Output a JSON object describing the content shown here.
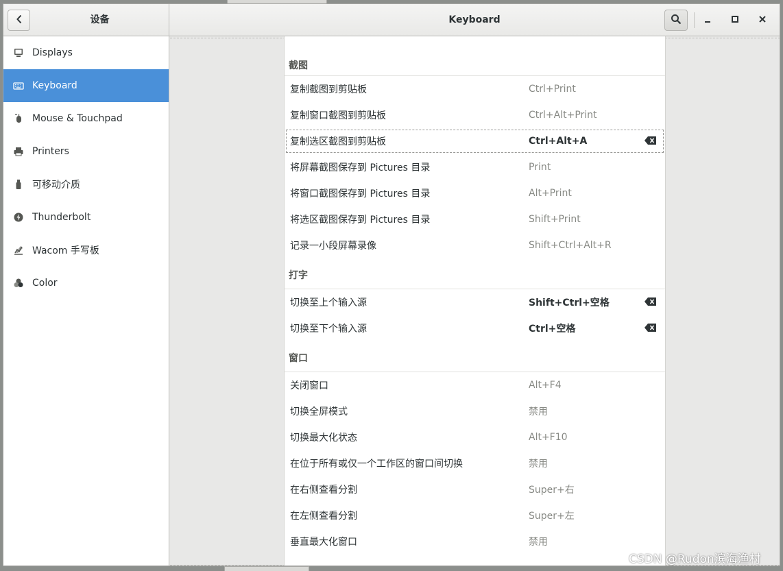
{
  "header": {
    "left_title": "设备",
    "center_title": "Keyboard"
  },
  "sidebar": {
    "items": [
      {
        "label": "Displays",
        "icon": "display-icon"
      },
      {
        "label": "Keyboard",
        "icon": "keyboard-icon",
        "active": true
      },
      {
        "label": "Mouse & Touchpad",
        "icon": "mouse-icon"
      },
      {
        "label": "Printers",
        "icon": "printer-icon"
      },
      {
        "label": "可移动介质",
        "icon": "usb-drive-icon"
      },
      {
        "label": "Thunderbolt",
        "icon": "thunderbolt-icon"
      },
      {
        "label": "Wacom 手写板",
        "icon": "tablet-icon"
      },
      {
        "label": "Color",
        "icon": "color-icon"
      }
    ]
  },
  "shortcuts": {
    "sections": [
      {
        "title": "截图",
        "rows": [
          {
            "name": "复制截图到剪贴板",
            "accel": "Ctrl+Print",
            "custom": false
          },
          {
            "name": "复制窗口截图到剪贴板",
            "accel": "Ctrl+Alt+Print",
            "custom": false
          },
          {
            "name": "复制选区截图到剪贴板",
            "accel": "Ctrl+Alt+A",
            "custom": true,
            "focused": true
          },
          {
            "name": "将屏幕截图保存到 Pictures 目录",
            "accel": "Print",
            "custom": false
          },
          {
            "name": "将窗口截图保存到 Pictures 目录",
            "accel": "Alt+Print",
            "custom": false
          },
          {
            "name": "将选区截图保存到 Pictures 目录",
            "accel": "Shift+Print",
            "custom": false
          },
          {
            "name": "记录一小段屏幕录像",
            "accel": "Shift+Ctrl+Alt+R",
            "custom": false
          }
        ]
      },
      {
        "title": "打字",
        "rows": [
          {
            "name": "切换至上个输入源",
            "accel": "Shift+Ctrl+空格",
            "custom": true
          },
          {
            "name": "切换至下个输入源",
            "accel": "Ctrl+空格",
            "custom": true
          }
        ]
      },
      {
        "title": "窗口",
        "rows": [
          {
            "name": "关闭窗口",
            "accel": "Alt+F4",
            "custom": false
          },
          {
            "name": "切换全屏模式",
            "accel": "禁用",
            "custom": false
          },
          {
            "name": "切换最大化状态",
            "accel": "Alt+F10",
            "custom": false
          },
          {
            "name": "在位于所有或仅一个工作区的窗口间切换",
            "accel": "禁用",
            "custom": false
          },
          {
            "name": "在右侧查看分割",
            "accel": "Super+右",
            "custom": false
          },
          {
            "name": "在左侧查看分割",
            "accel": "Super+左",
            "custom": false
          },
          {
            "name": "垂直最大化窗口",
            "accel": "禁用",
            "custom": false
          }
        ]
      }
    ]
  },
  "watermark": "CSDN @Rudon滨海渔村",
  "colors": {
    "accent": "#4a90d9",
    "accel_gray": "#888a85",
    "text": "#2e3436"
  }
}
